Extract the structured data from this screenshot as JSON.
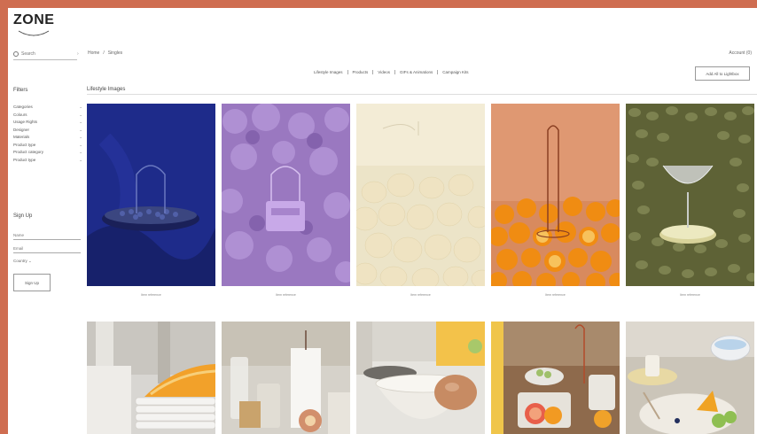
{
  "brand": {
    "name": "ZONE"
  },
  "search": {
    "placeholder": "Search"
  },
  "breadcrumb": [
    "Home",
    "/",
    "Singles"
  ],
  "account": {
    "label": "Account (0)"
  },
  "nav": {
    "items": [
      "Lifestyle Images",
      "Products",
      "Videos",
      "GIFs & Animations",
      "Campaign Kits"
    ]
  },
  "top_button": {
    "label": "Add All to Lightbox"
  },
  "filters": {
    "title": "Filters",
    "items": [
      "Categories",
      "Colours",
      "Usage Rights",
      "Designer",
      "Materials",
      "Product type",
      "Product category",
      "Product type"
    ]
  },
  "signup": {
    "title": "Sign Up",
    "name_placeholder": "Name",
    "email_placeholder": "Email",
    "country_label": "Country",
    "button_label": "Sign Up"
  },
  "section": {
    "title": "Lifestyle Images"
  },
  "captions": [
    "Item reference",
    "Item reference",
    "Item reference",
    "Item reference",
    "Item reference"
  ],
  "colors": {
    "frame_border": "#cf6d51",
    "page_bg": "#ffffff"
  }
}
